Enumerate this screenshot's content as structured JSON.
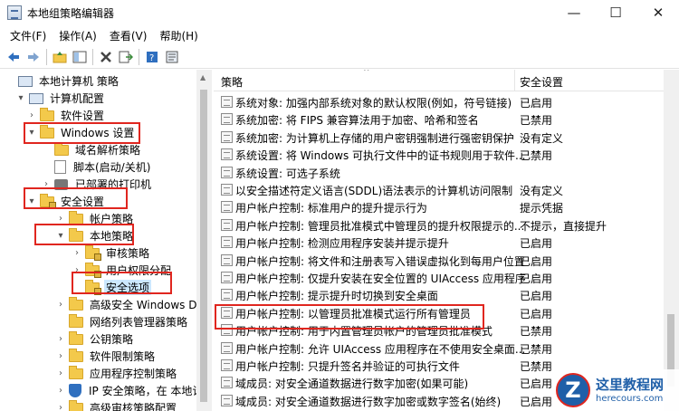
{
  "window": {
    "title": "本地组策略编辑器",
    "minimize": "—",
    "maximize": "☐",
    "close": "✕"
  },
  "menu": [
    "文件(F)",
    "操作(A)",
    "查看(V)",
    "帮助(H)"
  ],
  "toolbar": [
    "back-arrow-icon",
    "forward-arrow-icon",
    "up-folder-icon",
    "show-tree-icon",
    "delete-icon",
    "export-icon",
    "help-icon",
    "properties-icon"
  ],
  "tree": [
    {
      "label": "本地计算机 策略",
      "arrow": "",
      "icon": "pc"
    },
    {
      "label": "计算机配置",
      "arrow": "▾",
      "icon": "pc"
    },
    {
      "label": "软件设置",
      "arrow": "›",
      "icon": "folder"
    },
    {
      "label": "Windows 设置",
      "arrow": "▾",
      "icon": "folder"
    },
    {
      "label": "域名解析策略",
      "arrow": "",
      "icon": "folder"
    },
    {
      "label": "脚本(启动/关机)",
      "arrow": "",
      "icon": "doc"
    },
    {
      "label": "已部署的打印机",
      "arrow": "›",
      "icon": "printer"
    },
    {
      "label": "安全设置",
      "arrow": "▾",
      "icon": "lockfolder"
    },
    {
      "label": "帐户策略",
      "arrow": "›",
      "icon": "folder"
    },
    {
      "label": "本地策略",
      "arrow": "▾",
      "icon": "folder"
    },
    {
      "label": "审核策略",
      "arrow": "›",
      "icon": "lockfolder"
    },
    {
      "label": "用户权限分配",
      "arrow": "›",
      "icon": "lockfolder"
    },
    {
      "label": "安全选项",
      "arrow": "",
      "icon": "lockfolder"
    },
    {
      "label": "高级安全 Windows De",
      "arrow": "›",
      "icon": "folder"
    },
    {
      "label": "网络列表管理器策略",
      "arrow": "",
      "icon": "folder"
    },
    {
      "label": "公钥策略",
      "arrow": "›",
      "icon": "folder"
    },
    {
      "label": "软件限制策略",
      "arrow": "›",
      "icon": "folder"
    },
    {
      "label": "应用程序控制策略",
      "arrow": "›",
      "icon": "folder"
    },
    {
      "label": "IP 安全策略，在 本地计",
      "arrow": "›",
      "icon": "shield"
    },
    {
      "label": "高级审核策略配置",
      "arrow": "›",
      "icon": "folder"
    }
  ],
  "selected_tree_item": "安全选项",
  "list": {
    "col_policy": "策略",
    "col_setting": "安全设置",
    "sort_indicator": "^",
    "rows": [
      {
        "name": "系统对象: 加强内部系统对象的默认权限(例如，符号链接)",
        "value": "已启用"
      },
      {
        "name": "系统加密: 将 FIPS 兼容算法用于加密、哈希和签名",
        "value": "已禁用"
      },
      {
        "name": "系统加密: 为计算机上存储的用户密钥强制进行强密钥保护",
        "value": "没有定义"
      },
      {
        "name": "系统设置: 将 Windows 可执行文件中的证书规则用于软件...",
        "value": "已禁用"
      },
      {
        "name": "系统设置: 可选子系统",
        "value": ""
      },
      {
        "name": "以安全描述符定义语言(SDDL)语法表示的计算机访问限制",
        "value": "没有定义"
      },
      {
        "name": "用户帐户控制: 标准用户的提升提示行为",
        "value": "提示凭据"
      },
      {
        "name": "用户帐户控制: 管理员批准模式中管理员的提升权限提示的...",
        "value": "不提示，直接提升"
      },
      {
        "name": "用户帐户控制: 检测应用程序安装并提示提升",
        "value": "已启用"
      },
      {
        "name": "用户帐户控制: 将文件和注册表写入错误虚拟化到每用户位置",
        "value": "已启用"
      },
      {
        "name": "用户帐户控制: 仅提升安装在安全位置的 UIAccess 应用程序",
        "value": "已启用"
      },
      {
        "name": "用户帐户控制: 提示提升时切换到安全桌面",
        "value": "已启用"
      },
      {
        "name": "用户帐户控制: 以管理员批准模式运行所有管理员",
        "value": "已启用"
      },
      {
        "name": "用户帐户控制: 用于内置管理员帐户的管理员批准模式",
        "value": "已禁用"
      },
      {
        "name": "用户帐户控制: 允许 UIAccess 应用程序在不使用安全桌面...",
        "value": "已禁用"
      },
      {
        "name": "用户帐户控制: 只提升签名并验证的可执行文件",
        "value": "已禁用"
      },
      {
        "name": "域成员: 对安全通道数据进行数字加密(如果可能)",
        "value": "已启用"
      },
      {
        "name": "域成员: 对安全通道数据进行数字加密或数字签名(始终)",
        "value": "已启用"
      }
    ]
  },
  "watermark": {
    "logo": "Z",
    "title": "这里教程网",
    "url": "herecours.com"
  },
  "colors": {
    "highlight_red": "#e0261f",
    "selection": "#cce8ff",
    "folder": "#f3c94b"
  }
}
